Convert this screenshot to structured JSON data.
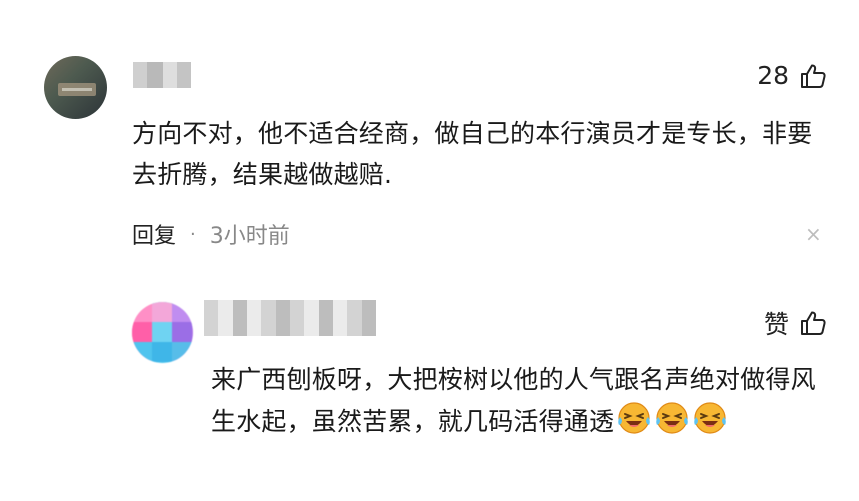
{
  "comment": {
    "author_name": "",
    "like_count": "28",
    "text": "方向不对，他不适合经商，做自己的本行演员才是专长，非要去折腾，结果越做越赔.",
    "reply_label": "回复",
    "separator": "·",
    "time": "3小时前"
  },
  "reply": {
    "author_name": "",
    "like_label": "赞",
    "text": "来广西刨板呀，大把桉树以他的人气跟名声绝对做得风生水起，虽然苦累，就几码活得通透",
    "emojis": [
      "laughing-crying-emoji",
      "laughing-crying-emoji",
      "laughing-crying-emoji"
    ]
  },
  "icons": {
    "like": "thumb-up-icon",
    "close": "close-icon",
    "close_glyph": "×"
  },
  "colors": {
    "text": "#1a1a1a",
    "muted": "#888888",
    "emoji_face": "#f7b733"
  }
}
